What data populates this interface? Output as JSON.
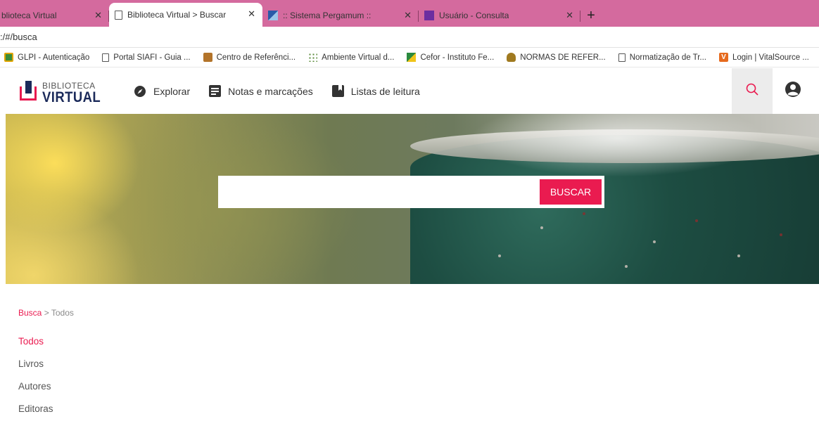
{
  "browser": {
    "tabs": [
      {
        "title": "blioteca Virtual",
        "close": "✕"
      },
      {
        "title": "Biblioteca Virtual > Buscar",
        "close": "✕"
      },
      {
        "title": ":: Sistema Pergamum ::",
        "close": "✕"
      },
      {
        "title": "Usuário - Consulta",
        "close": "✕"
      }
    ],
    "new_tab": "+",
    "url": ":/#/busca",
    "bookmarks": [
      {
        "label": "GLPI - Autenticação",
        "icon": "glpi-icon"
      },
      {
        "label": "Portal SIAFI - Guia ...",
        "icon": "page-icon"
      },
      {
        "label": "Centro de Referênci...",
        "icon": "cr-icon"
      },
      {
        "label": "Ambiente Virtual d...",
        "icon": "ava-icon"
      },
      {
        "label": "Cefor - Instituto Fe...",
        "icon": "cefor-icon"
      },
      {
        "label": "NORMAS DE REFER...",
        "icon": "crest-icon"
      },
      {
        "label": "Normatização de Tr...",
        "icon": "page-icon"
      },
      {
        "label": "Login | VitalSource ...",
        "icon": "vitalsource-icon"
      }
    ]
  },
  "site": {
    "logo_small": "BIBLIOTECA",
    "logo_big": "VIRTUAL",
    "nav": [
      {
        "label": "Explorar",
        "icon": "compass-icon"
      },
      {
        "label": "Notas e marcações",
        "icon": "notes-icon"
      },
      {
        "label": "Listas de leitura",
        "icon": "bookmark-icon"
      }
    ],
    "accent": "#ea1b50"
  },
  "search": {
    "value": "",
    "placeholder": "",
    "button_label": "BUSCAR"
  },
  "breadcrumb": {
    "link": "Busca",
    "separator": ">",
    "current": "Todos"
  },
  "filters": [
    {
      "label": "Todos",
      "active": true
    },
    {
      "label": "Livros",
      "active": false
    },
    {
      "label": "Autores",
      "active": false
    },
    {
      "label": "Editoras",
      "active": false
    }
  ]
}
